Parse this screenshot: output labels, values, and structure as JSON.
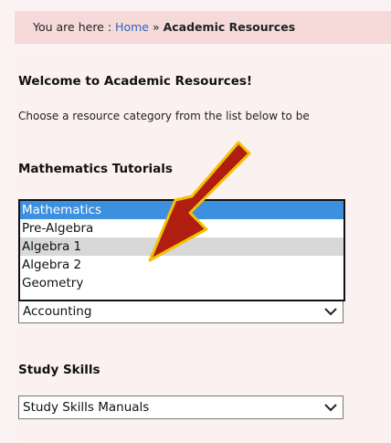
{
  "breadcrumb": {
    "prefix": "You are here :",
    "home": "Home",
    "separator": "»",
    "current": "Academic Resources"
  },
  "welcome_heading": "Welcome to Academic Resources!",
  "intro_text": "Choose a resource category from the list below to be",
  "math": {
    "heading": "Mathematics Tutorials",
    "options": [
      "Mathematics",
      "Pre-Algebra",
      "Algebra 1",
      "Algebra 2",
      "Geometry"
    ],
    "selected_index": 0,
    "hover_index": 2
  },
  "accounting_select": {
    "value": "Accounting"
  },
  "study_skills": {
    "heading": "Study Skills",
    "value": "Study Skills Manuals"
  },
  "colors": {
    "breadcrumb_bg": "#f6dada",
    "link": "#2e66b8",
    "selected_option": "#3d8fe0",
    "arrow_fill": "#b01e12",
    "arrow_outline": "#f2c300"
  },
  "icons": {
    "dropdown": "chevron-down-icon",
    "annotation": "red-arrow-icon"
  }
}
